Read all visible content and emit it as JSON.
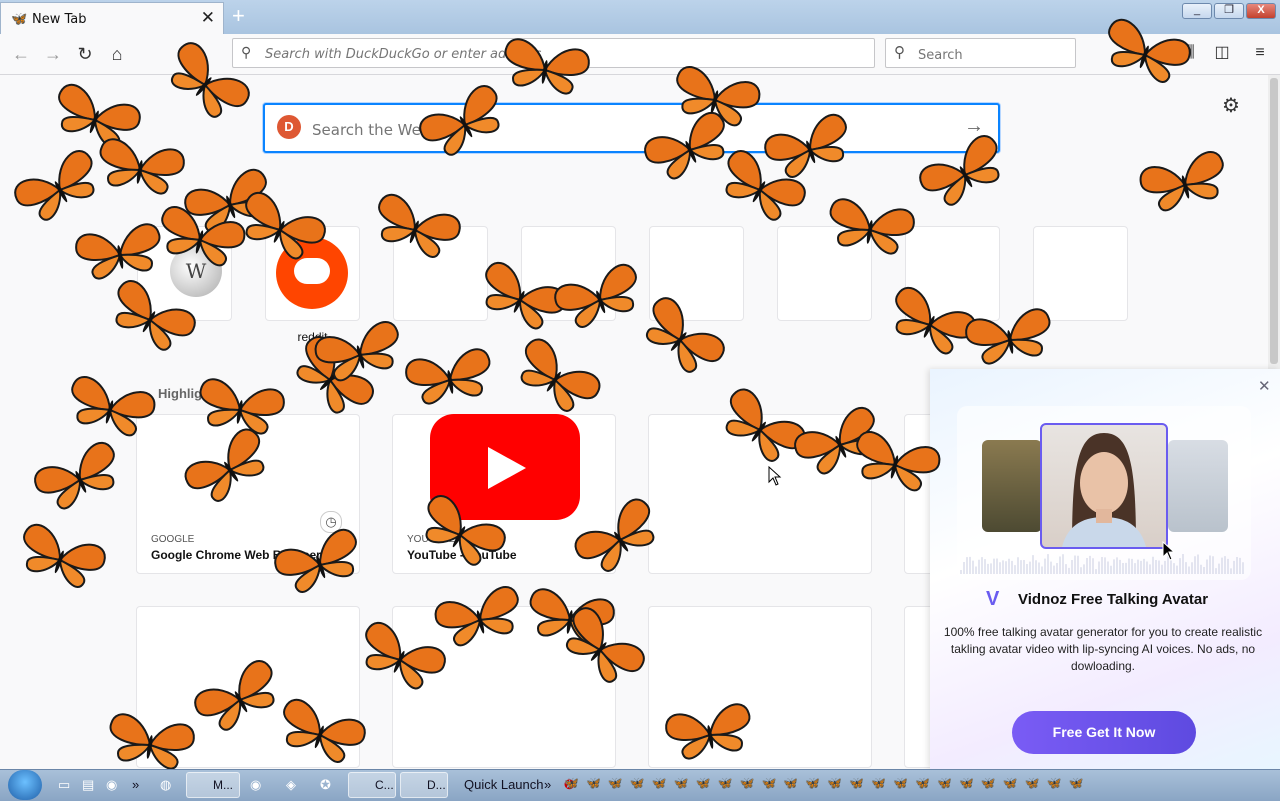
{
  "tab": {
    "title": "New Tab"
  },
  "window": {
    "minimize": "_",
    "restore": "❐",
    "close": "X"
  },
  "toolbar": {
    "url_placeholder": "Search with DuckDuckGo or enter address",
    "search_placeholder": "Search"
  },
  "newtab": {
    "search_placeholder": "Search the Web",
    "top_sites": [
      {
        "label": "",
        "icon": "wikipedia-icon"
      },
      {
        "label": "reddit",
        "icon": "reddit-icon"
      }
    ],
    "highlights_heading": "Highlights",
    "highlights": [
      {
        "source": "GOOGLE",
        "title": "Google Chrome Web Browser"
      },
      {
        "source": "YOUTUBE",
        "title": "YouTube - YouTube"
      }
    ]
  },
  "popup": {
    "title": "Vidnoz Free Talking Avatar",
    "description": "100% free talking avatar generator for you to create realistic takling avatar video with lip-syncing AI voices. No ads, no dowloading.",
    "button": "Free Get It Now"
  },
  "taskbar": {
    "items": [
      "M...",
      "C...",
      "D..."
    ],
    "quick_launch": "Quick Launch"
  },
  "colors": {
    "butterfly": "#e8731a",
    "accent": "#0a84ff",
    "vidnoz": "#6a5cf0"
  }
}
